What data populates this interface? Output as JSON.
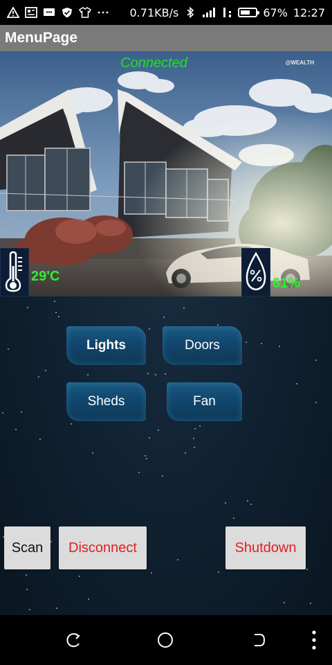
{
  "status_bar": {
    "net_speed": "0.71KB/s",
    "battery_percent": "67%",
    "battery_level": 0.67,
    "time": "12:27",
    "icons": [
      "warning-icon",
      "news-icon",
      "message-icon",
      "shield-icon",
      "shirt-icon",
      "more-icon",
      "bluetooth-icon",
      "signal-icon",
      "wifi-icon",
      "battery-icon"
    ]
  },
  "title_bar": {
    "title": "MenuPage"
  },
  "hero": {
    "connection_status": "Connected",
    "watermark": "@WEALTH",
    "temperature": "29'C",
    "humidity": "61%",
    "colors": {
      "status_green": "#22e022",
      "reading_green": "#33ee33"
    }
  },
  "rooms": {
    "lights": "Lights",
    "doors": "Doors",
    "sheds": "Sheds",
    "fan": "Fan"
  },
  "actions": {
    "scan": "Scan",
    "disconnect": "Disconnect",
    "shutdown": "Shutdown",
    "colors": {
      "danger": "#e02020"
    }
  },
  "nav_bar": {
    "icons": [
      "back-icon",
      "home-icon",
      "recents-icon",
      "menu-dots-icon"
    ]
  }
}
